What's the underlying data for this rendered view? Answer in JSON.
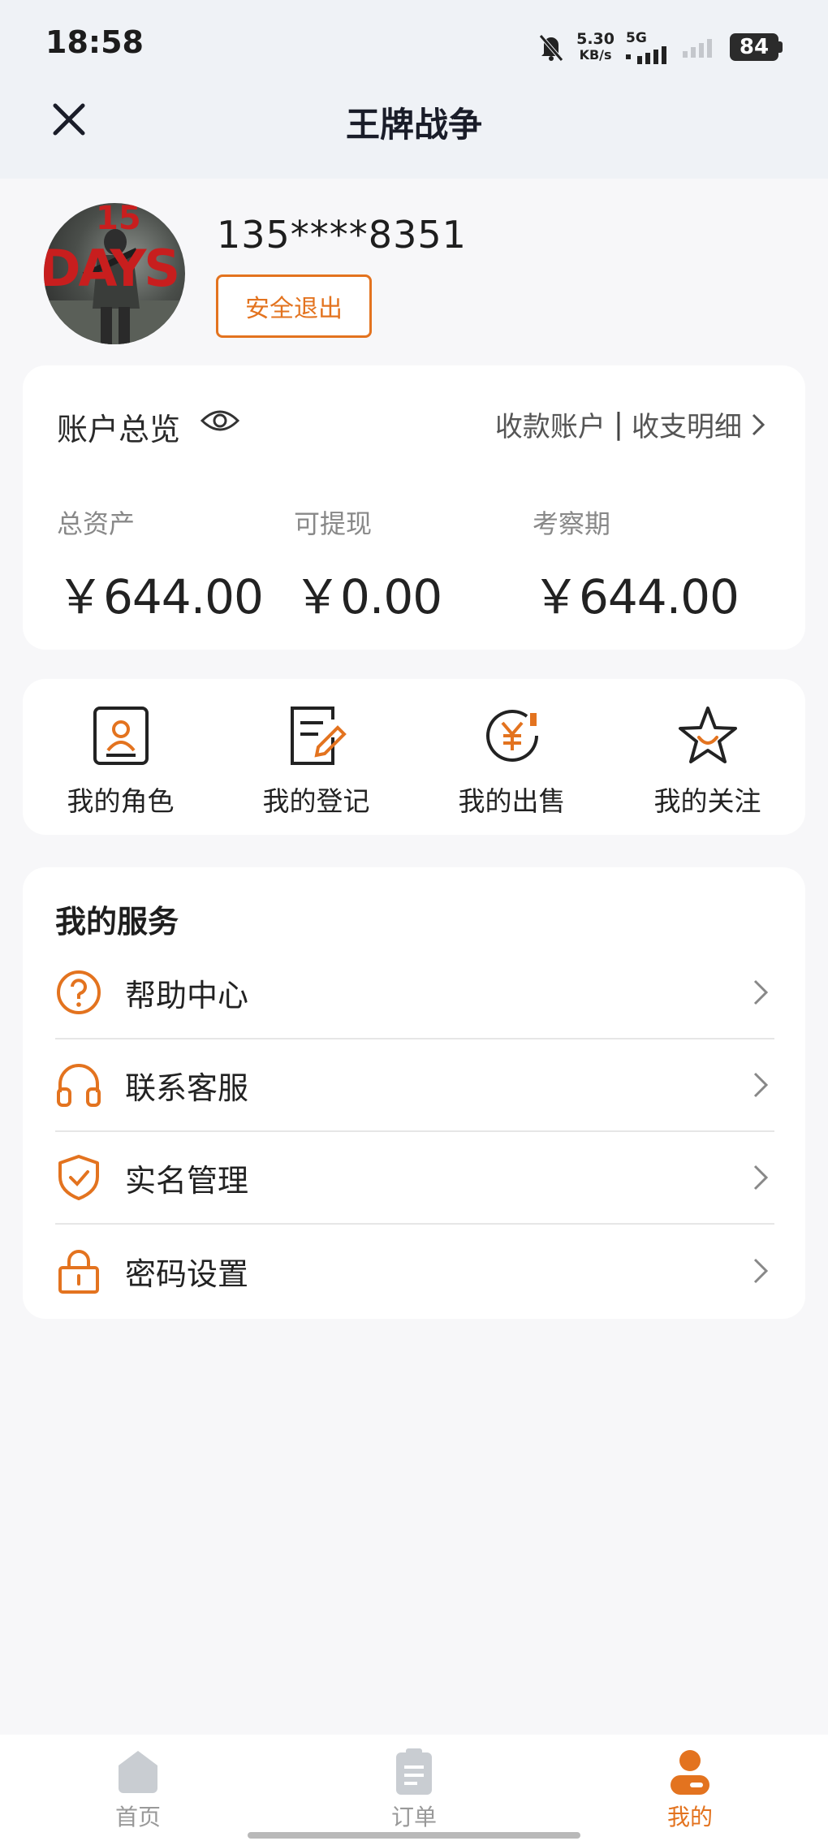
{
  "status_bar": {
    "time": "18:58",
    "net_speed": "5.30",
    "net_unit": "KB/s",
    "network": "5G",
    "battery": "84"
  },
  "header": {
    "title": "王牌战争",
    "close_icon": "close-icon"
  },
  "profile": {
    "avatar_text_top": "15",
    "avatar_text_bottom": "DAYS",
    "phone": "135****8351",
    "logout_label": "安全退出"
  },
  "overview": {
    "title": "账户总览",
    "link_receive": "收款账户",
    "link_separator": "|",
    "link_detail": "收支明细",
    "stats": [
      {
        "label": "总资产",
        "value": "￥644.00"
      },
      {
        "label": "可提现",
        "value": "￥0.00"
      },
      {
        "label": "考察期",
        "value": "￥644.00"
      }
    ]
  },
  "quick_actions": [
    {
      "label": "我的角色",
      "icon": "role-card-icon"
    },
    {
      "label": "我的登记",
      "icon": "register-edit-icon"
    },
    {
      "label": "我的出售",
      "icon": "sell-yuan-icon"
    },
    {
      "label": "我的关注",
      "icon": "star-icon"
    }
  ],
  "services": {
    "title": "我的服务",
    "items": [
      {
        "label": "帮助中心",
        "icon": "help-icon"
      },
      {
        "label": "联系客服",
        "icon": "headset-icon"
      },
      {
        "label": "实名管理",
        "icon": "shield-check-icon"
      },
      {
        "label": "密码设置",
        "icon": "lock-icon"
      }
    ]
  },
  "tabbar": {
    "tabs": [
      {
        "label": "首页",
        "icon": "home-icon",
        "active": false
      },
      {
        "label": "订单",
        "icon": "order-icon",
        "active": false
      },
      {
        "label": "我的",
        "icon": "profile-icon",
        "active": true
      }
    ]
  },
  "colors": {
    "accent": "#e3731f",
    "background": "#f7f7f9",
    "header_bg": "#eff2f6"
  }
}
